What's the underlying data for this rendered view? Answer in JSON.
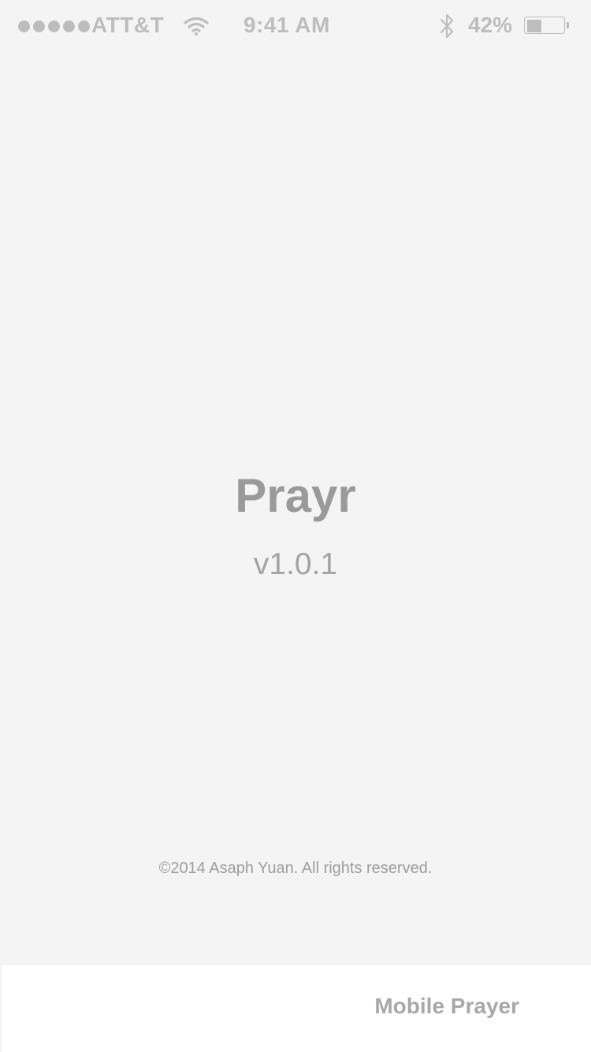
{
  "status_bar": {
    "carrier": "ATT&T",
    "time": "9:41 AM",
    "battery_percent_text": "42%",
    "battery_level": 0.42,
    "signal_bars": 5,
    "icons": [
      "signal-dots-icon",
      "wifi-icon",
      "bluetooth-icon",
      "battery-icon"
    ],
    "color": "#bdbdbd"
  },
  "main": {
    "title": "Prayr",
    "version": "v1.0.1",
    "copyright": "©2014 Asaph Yuan. All rights reserved."
  },
  "bottom_bar": {
    "button_label": "Mobile Prayer"
  },
  "colors": {
    "background": "#f4f4f4",
    "bottom_bar": "#ffffff",
    "text_muted": "#9a9a9a"
  }
}
